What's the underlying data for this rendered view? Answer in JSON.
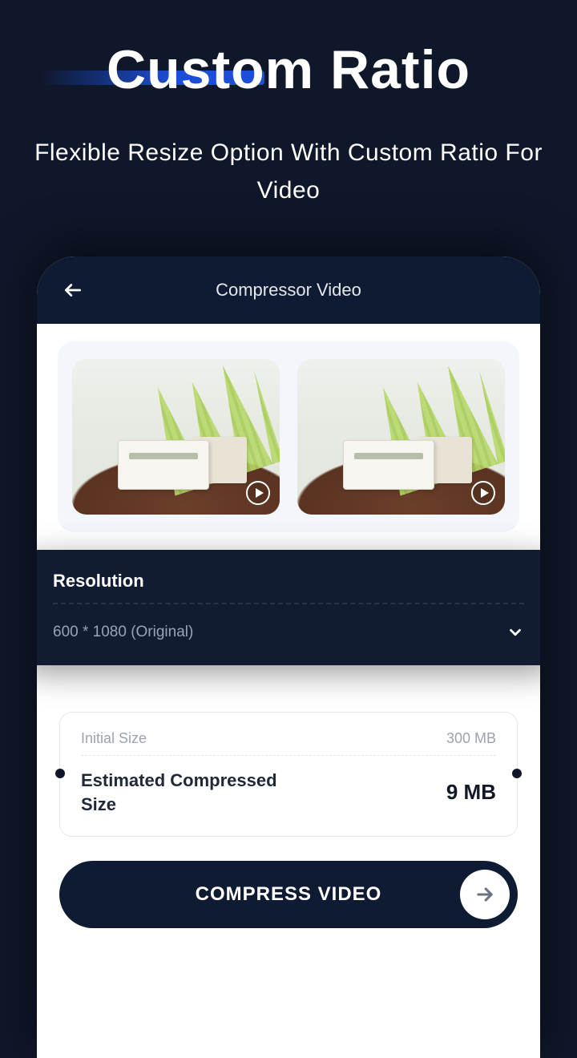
{
  "promo": {
    "title": "Custom Ratio",
    "subtitle": "Flexible Resize Option With Custom Ratio For Video"
  },
  "appbar": {
    "title": "Compressor Video"
  },
  "resolution": {
    "label": "Resolution",
    "value": "600 * 1080 (Original)"
  },
  "size": {
    "initial_label": "Initial Size",
    "initial_value": "300 MB",
    "estimated_label": "Estimated Compressed Size",
    "estimated_value": "9 MB"
  },
  "action": {
    "compress_label": "COMPRESS VIDEO"
  }
}
